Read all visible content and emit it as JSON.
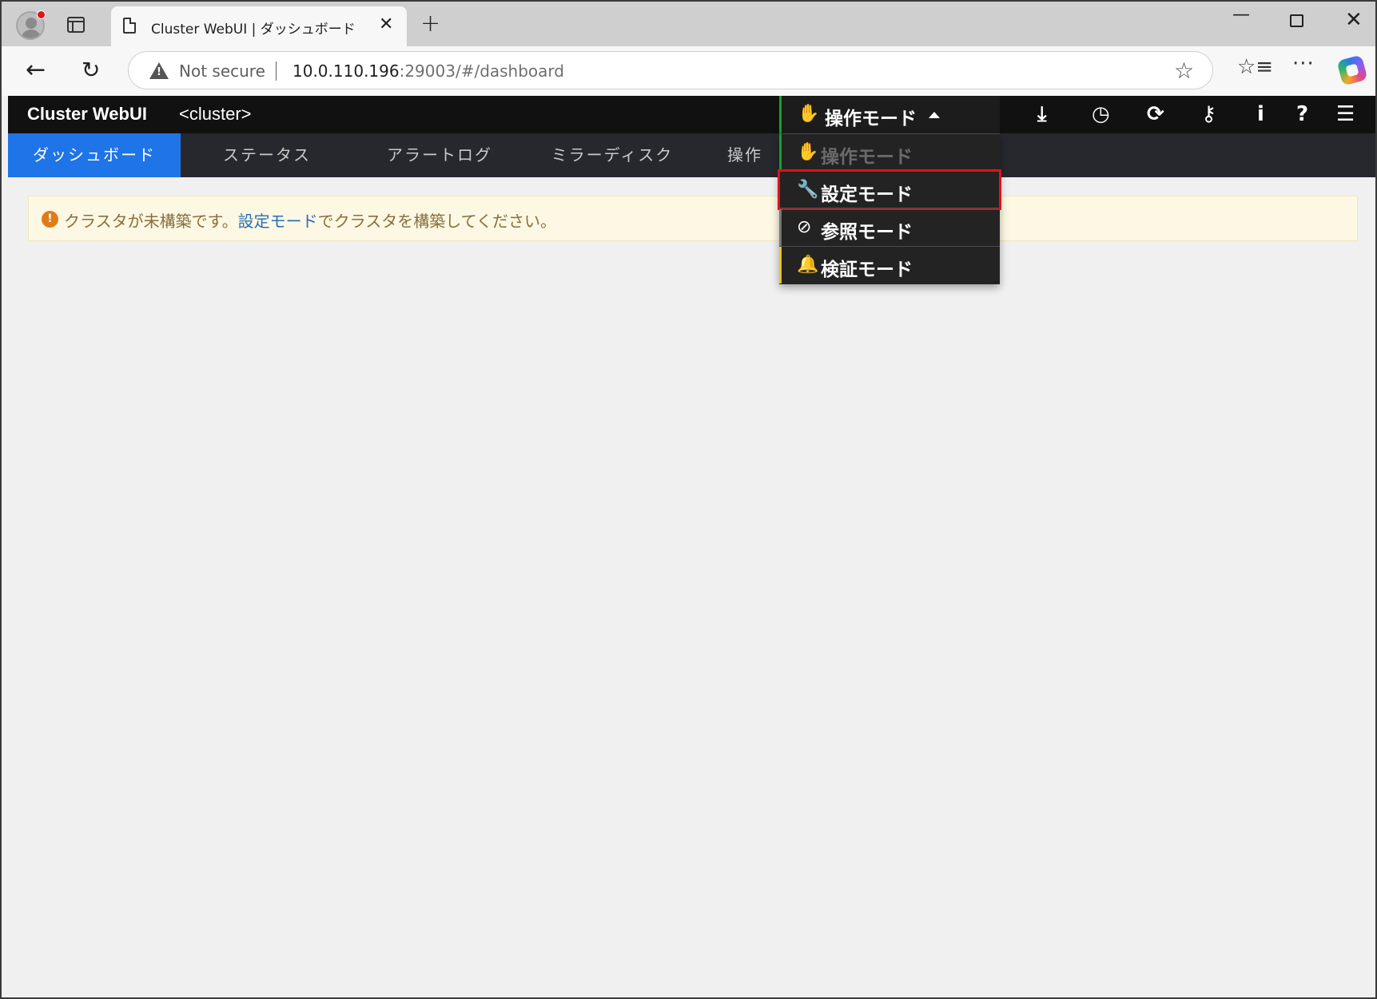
{
  "browser": {
    "tab_title": "Cluster WebUI | ダッシュボード",
    "security_label": "Not secure",
    "url_host": "10.0.110.196",
    "url_rest": ":29003/#/dashboard"
  },
  "app": {
    "title": "Cluster WebUI",
    "cluster_name": "<cluster>"
  },
  "nav": {
    "items": [
      {
        "label": "ダッシュボード",
        "active": true
      },
      {
        "label": "ステータス",
        "active": false
      },
      {
        "label": "アラートログ",
        "active": false
      },
      {
        "label": "ミラーディスク",
        "active": false
      },
      {
        "label": "操作",
        "active": false
      }
    ]
  },
  "mode_dropdown": {
    "current_label": "操作モード",
    "items": [
      {
        "label": "操作モード",
        "icon": "hand-icon",
        "disabled": true,
        "color": "#6a6a6a"
      },
      {
        "label": "設定モード",
        "icon": "wrench-icon",
        "disabled": false,
        "highlighted": true
      },
      {
        "label": "参照モード",
        "icon": "ban-icon",
        "disabled": false
      },
      {
        "label": "検証モード",
        "icon": "bell-icon",
        "disabled": false,
        "color": "#f0c419"
      }
    ]
  },
  "alert": {
    "prefix": "クラスタが未構築です。",
    "link": "設定モード",
    "suffix": "でクラスタを構築してください。"
  },
  "header_icons": [
    "download-icon",
    "clock-icon",
    "refresh-icon",
    "key-icon",
    "info-icon",
    "help-icon",
    "list-info-icon"
  ],
  "colors": {
    "accent": "#1f74e8",
    "operation_mode": "#1a9e2c",
    "verification_mode": "#f0c419",
    "highlight": "#e0121b"
  }
}
